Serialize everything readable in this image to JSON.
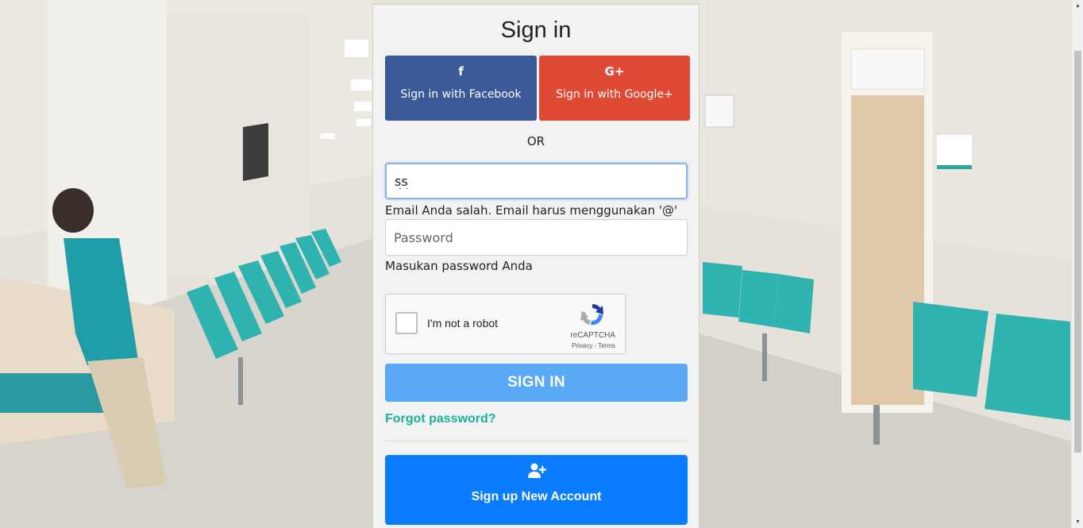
{
  "page": {
    "title": "Sign in",
    "accent": "#0a7cff"
  },
  "social": {
    "facebook": {
      "label": "Sign in with Facebook",
      "icon": "facebook-icon",
      "icon_glyph": "f",
      "color": "#3b5998"
    },
    "google": {
      "label": "Sign in with Google+",
      "icon": "google-plus-icon",
      "icon_glyph": "G+",
      "color": "#df4a37"
    }
  },
  "separator": "OR",
  "form": {
    "email_value": "ss",
    "email_error": "Email Anda salah. Email harus menggunakan '@'",
    "password_placeholder": "Password",
    "password_hint": "Masukan password Anda"
  },
  "captcha": {
    "label": "I'm not a robot",
    "brand": "reCAPTCHA",
    "terms": "Privacy - Terms"
  },
  "actions": {
    "signin_label": "SIGN IN",
    "forgot_label": "Forgot password?",
    "signup_label": "Sign up New Account",
    "signup_icon": "user-plus-icon"
  }
}
